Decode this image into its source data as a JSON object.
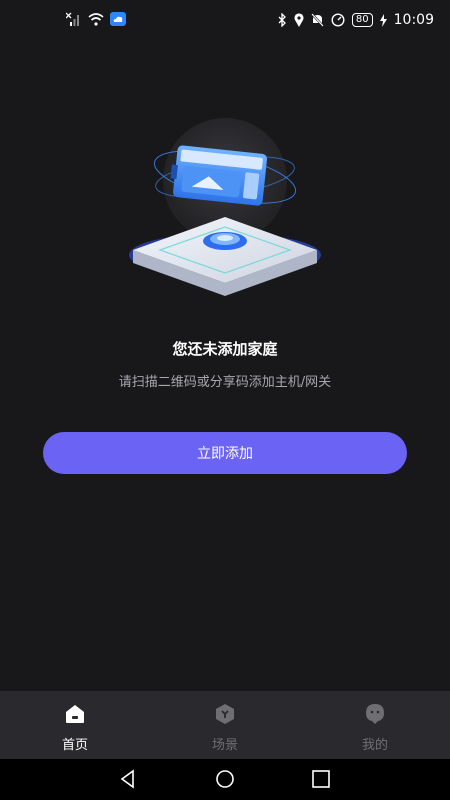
{
  "status_bar": {
    "time": "10:09",
    "battery": "80",
    "icons_left": [
      "signal-off-icon",
      "wifi-icon",
      "cloud-app-icon"
    ],
    "icons_right": [
      "bluetooth-icon",
      "location-icon",
      "mute-icon",
      "speed-icon",
      "battery-icon",
      "charging-icon"
    ]
  },
  "empty_state": {
    "title": "您还未添加家庭",
    "description": "请扫描二维码或分享码添加主机/网关",
    "add_button": "立即添加"
  },
  "tabs": [
    {
      "label": "首页",
      "icon": "home-icon",
      "active": true
    },
    {
      "label": "场景",
      "icon": "scene-icon",
      "active": false
    },
    {
      "label": "我的",
      "icon": "profile-icon",
      "active": false
    }
  ],
  "colors": {
    "background": "#18181b",
    "accent": "#6b63f4",
    "tab_bar": "#2a2a2e",
    "inactive": "#6e6e73"
  }
}
